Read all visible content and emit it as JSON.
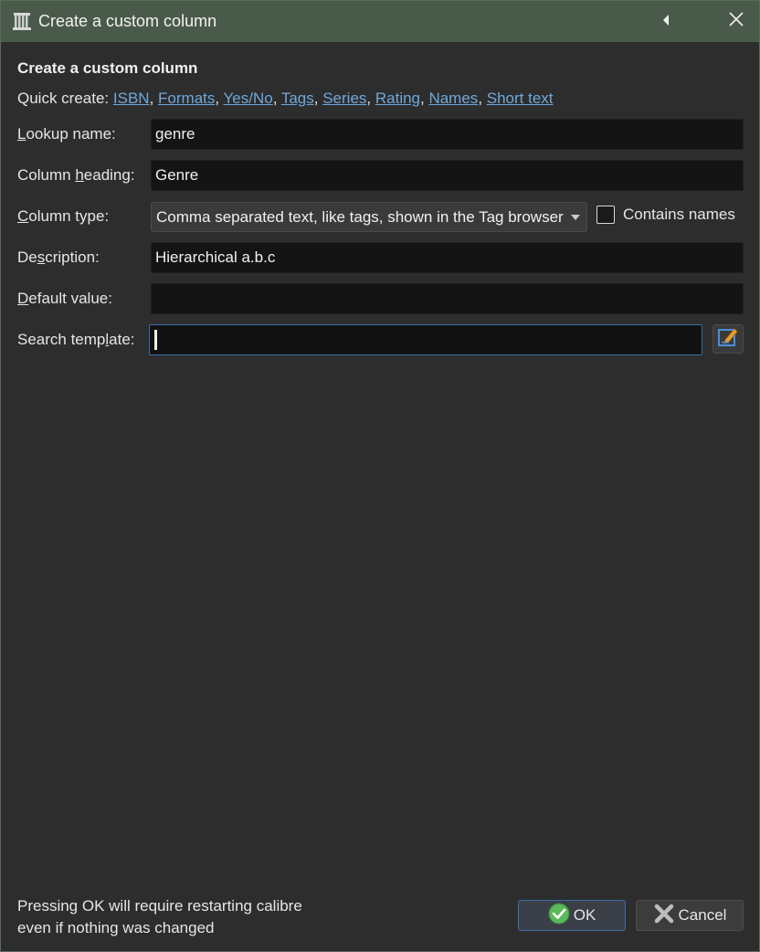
{
  "window": {
    "title": "Create a custom column",
    "accent": "#4a5a4a"
  },
  "heading": "Create a custom column",
  "quick_create": {
    "label": "Quick create:",
    "links": [
      "ISBN",
      "Formats",
      "Yes/No",
      "Tags",
      "Series",
      "Rating",
      "Names",
      "Short text"
    ],
    "link_color": "#6fa8dc"
  },
  "fields": {
    "lookup_name": {
      "label_pre": "",
      "label_u": "L",
      "label_post": "ookup name:",
      "value": "genre"
    },
    "column_heading": {
      "label_pre": "Column ",
      "label_u": "h",
      "label_post": "eading:",
      "value": "Genre"
    },
    "column_type": {
      "label_pre": "",
      "label_u": "C",
      "label_post": "olumn type:",
      "value": "Comma separated text, like tags, shown in the Tag browser"
    },
    "description": {
      "label_pre": "De",
      "label_u": "s",
      "label_post": "cription:",
      "value": "Hierarchical a.b.c"
    },
    "default_value": {
      "label_pre": "",
      "label_u": "D",
      "label_post": "efault value:",
      "value": ""
    },
    "search_template": {
      "label_pre": "Search temp",
      "label_u": "l",
      "label_post": "ate:",
      "value": ""
    }
  },
  "contains_names": {
    "label": "Contains names",
    "checked": false
  },
  "footer": {
    "line1": "Pressing OK will require restarting calibre",
    "line2": "even if nothing was changed"
  },
  "buttons": {
    "ok": "OK",
    "cancel": "Cancel"
  },
  "icons": {
    "app": "calibre-library-icon",
    "collapse": "triangle-left-icon",
    "close": "close-icon",
    "edit": "edit-template-icon",
    "ok": "check-circle-icon",
    "cancel": "x-icon"
  }
}
